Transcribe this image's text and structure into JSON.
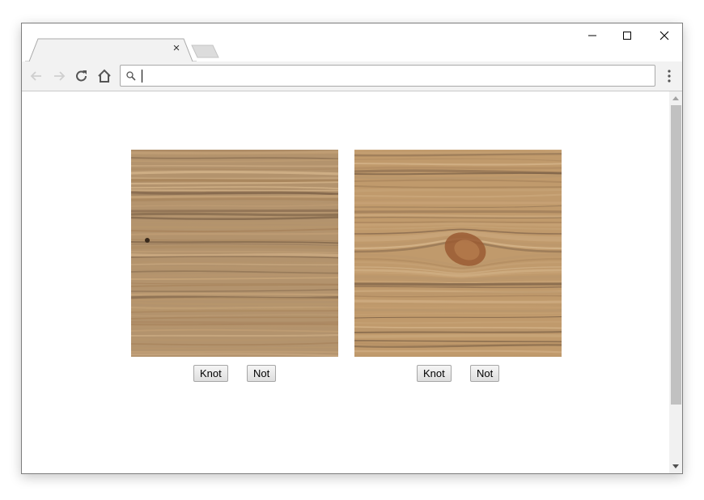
{
  "browser": {
    "tabs": [
      {
        "title": "",
        "active": true,
        "close_label": "×"
      },
      {
        "title": "",
        "active": false,
        "new_tab": true
      }
    ],
    "window_controls": [
      "minimize",
      "maximize",
      "close"
    ],
    "nav": {
      "back": "back-arrow-icon",
      "forward": "forward-arrow-icon",
      "reload": "reload-icon",
      "home": "home-icon"
    },
    "address_bar": {
      "value": "",
      "placeholder": ""
    },
    "menu": "kebab-menu-icon"
  },
  "page": {
    "panels": [
      {
        "image_description": "Wood board texture with straight grain, no visible knot",
        "buttons": [
          {
            "label": "Knot"
          },
          {
            "label": "Not"
          }
        ]
      },
      {
        "image_description": "Wood board texture with a visible knot in the center",
        "buttons": [
          {
            "label": "Knot"
          },
          {
            "label": "Not"
          }
        ]
      }
    ]
  },
  "colors": {
    "wood_light": "#c9a67a",
    "wood_mid": "#a8845c",
    "wood_dark": "#7d6248",
    "knot": "#9a5a32"
  }
}
